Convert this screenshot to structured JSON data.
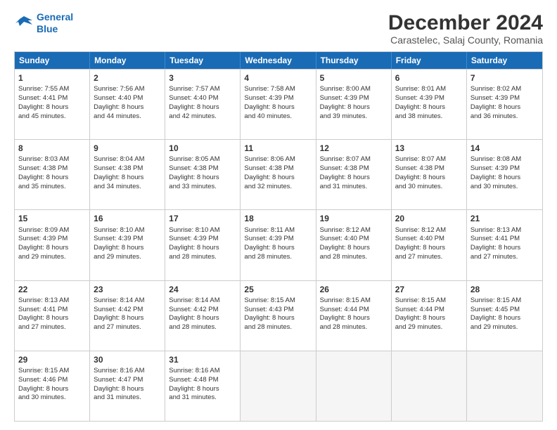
{
  "logo": {
    "line1": "General",
    "line2": "Blue"
  },
  "title": "December 2024",
  "subtitle": "Carastelec, Salaj County, Romania",
  "headers": [
    "Sunday",
    "Monday",
    "Tuesday",
    "Wednesday",
    "Thursday",
    "Friday",
    "Saturday"
  ],
  "weeks": [
    [
      {
        "day": "1",
        "lines": [
          "Sunrise: 7:55 AM",
          "Sunset: 4:41 PM",
          "Daylight: 8 hours",
          "and 45 minutes."
        ]
      },
      {
        "day": "2",
        "lines": [
          "Sunrise: 7:56 AM",
          "Sunset: 4:40 PM",
          "Daylight: 8 hours",
          "and 44 minutes."
        ]
      },
      {
        "day": "3",
        "lines": [
          "Sunrise: 7:57 AM",
          "Sunset: 4:40 PM",
          "Daylight: 8 hours",
          "and 42 minutes."
        ]
      },
      {
        "day": "4",
        "lines": [
          "Sunrise: 7:58 AM",
          "Sunset: 4:39 PM",
          "Daylight: 8 hours",
          "and 40 minutes."
        ]
      },
      {
        "day": "5",
        "lines": [
          "Sunrise: 8:00 AM",
          "Sunset: 4:39 PM",
          "Daylight: 8 hours",
          "and 39 minutes."
        ]
      },
      {
        "day": "6",
        "lines": [
          "Sunrise: 8:01 AM",
          "Sunset: 4:39 PM",
          "Daylight: 8 hours",
          "and 38 minutes."
        ]
      },
      {
        "day": "7",
        "lines": [
          "Sunrise: 8:02 AM",
          "Sunset: 4:39 PM",
          "Daylight: 8 hours",
          "and 36 minutes."
        ]
      }
    ],
    [
      {
        "day": "8",
        "lines": [
          "Sunrise: 8:03 AM",
          "Sunset: 4:38 PM",
          "Daylight: 8 hours",
          "and 35 minutes."
        ]
      },
      {
        "day": "9",
        "lines": [
          "Sunrise: 8:04 AM",
          "Sunset: 4:38 PM",
          "Daylight: 8 hours",
          "and 34 minutes."
        ]
      },
      {
        "day": "10",
        "lines": [
          "Sunrise: 8:05 AM",
          "Sunset: 4:38 PM",
          "Daylight: 8 hours",
          "and 33 minutes."
        ]
      },
      {
        "day": "11",
        "lines": [
          "Sunrise: 8:06 AM",
          "Sunset: 4:38 PM",
          "Daylight: 8 hours",
          "and 32 minutes."
        ]
      },
      {
        "day": "12",
        "lines": [
          "Sunrise: 8:07 AM",
          "Sunset: 4:38 PM",
          "Daylight: 8 hours",
          "and 31 minutes."
        ]
      },
      {
        "day": "13",
        "lines": [
          "Sunrise: 8:07 AM",
          "Sunset: 4:38 PM",
          "Daylight: 8 hours",
          "and 30 minutes."
        ]
      },
      {
        "day": "14",
        "lines": [
          "Sunrise: 8:08 AM",
          "Sunset: 4:39 PM",
          "Daylight: 8 hours",
          "and 30 minutes."
        ]
      }
    ],
    [
      {
        "day": "15",
        "lines": [
          "Sunrise: 8:09 AM",
          "Sunset: 4:39 PM",
          "Daylight: 8 hours",
          "and 29 minutes."
        ]
      },
      {
        "day": "16",
        "lines": [
          "Sunrise: 8:10 AM",
          "Sunset: 4:39 PM",
          "Daylight: 8 hours",
          "and 29 minutes."
        ]
      },
      {
        "day": "17",
        "lines": [
          "Sunrise: 8:10 AM",
          "Sunset: 4:39 PM",
          "Daylight: 8 hours",
          "and 28 minutes."
        ]
      },
      {
        "day": "18",
        "lines": [
          "Sunrise: 8:11 AM",
          "Sunset: 4:39 PM",
          "Daylight: 8 hours",
          "and 28 minutes."
        ]
      },
      {
        "day": "19",
        "lines": [
          "Sunrise: 8:12 AM",
          "Sunset: 4:40 PM",
          "Daylight: 8 hours",
          "and 28 minutes."
        ]
      },
      {
        "day": "20",
        "lines": [
          "Sunrise: 8:12 AM",
          "Sunset: 4:40 PM",
          "Daylight: 8 hours",
          "and 27 minutes."
        ]
      },
      {
        "day": "21",
        "lines": [
          "Sunrise: 8:13 AM",
          "Sunset: 4:41 PM",
          "Daylight: 8 hours",
          "and 27 minutes."
        ]
      }
    ],
    [
      {
        "day": "22",
        "lines": [
          "Sunrise: 8:13 AM",
          "Sunset: 4:41 PM",
          "Daylight: 8 hours",
          "and 27 minutes."
        ]
      },
      {
        "day": "23",
        "lines": [
          "Sunrise: 8:14 AM",
          "Sunset: 4:42 PM",
          "Daylight: 8 hours",
          "and 27 minutes."
        ]
      },
      {
        "day": "24",
        "lines": [
          "Sunrise: 8:14 AM",
          "Sunset: 4:42 PM",
          "Daylight: 8 hours",
          "and 28 minutes."
        ]
      },
      {
        "day": "25",
        "lines": [
          "Sunrise: 8:15 AM",
          "Sunset: 4:43 PM",
          "Daylight: 8 hours",
          "and 28 minutes."
        ]
      },
      {
        "day": "26",
        "lines": [
          "Sunrise: 8:15 AM",
          "Sunset: 4:44 PM",
          "Daylight: 8 hours",
          "and 28 minutes."
        ]
      },
      {
        "day": "27",
        "lines": [
          "Sunrise: 8:15 AM",
          "Sunset: 4:44 PM",
          "Daylight: 8 hours",
          "and 29 minutes."
        ]
      },
      {
        "day": "28",
        "lines": [
          "Sunrise: 8:15 AM",
          "Sunset: 4:45 PM",
          "Daylight: 8 hours",
          "and 29 minutes."
        ]
      }
    ],
    [
      {
        "day": "29",
        "lines": [
          "Sunrise: 8:15 AM",
          "Sunset: 4:46 PM",
          "Daylight: 8 hours",
          "and 30 minutes."
        ]
      },
      {
        "day": "30",
        "lines": [
          "Sunrise: 8:16 AM",
          "Sunset: 4:47 PM",
          "Daylight: 8 hours",
          "and 31 minutes."
        ]
      },
      {
        "day": "31",
        "lines": [
          "Sunrise: 8:16 AM",
          "Sunset: 4:48 PM",
          "Daylight: 8 hours",
          "and 31 minutes."
        ]
      },
      null,
      null,
      null,
      null
    ]
  ]
}
